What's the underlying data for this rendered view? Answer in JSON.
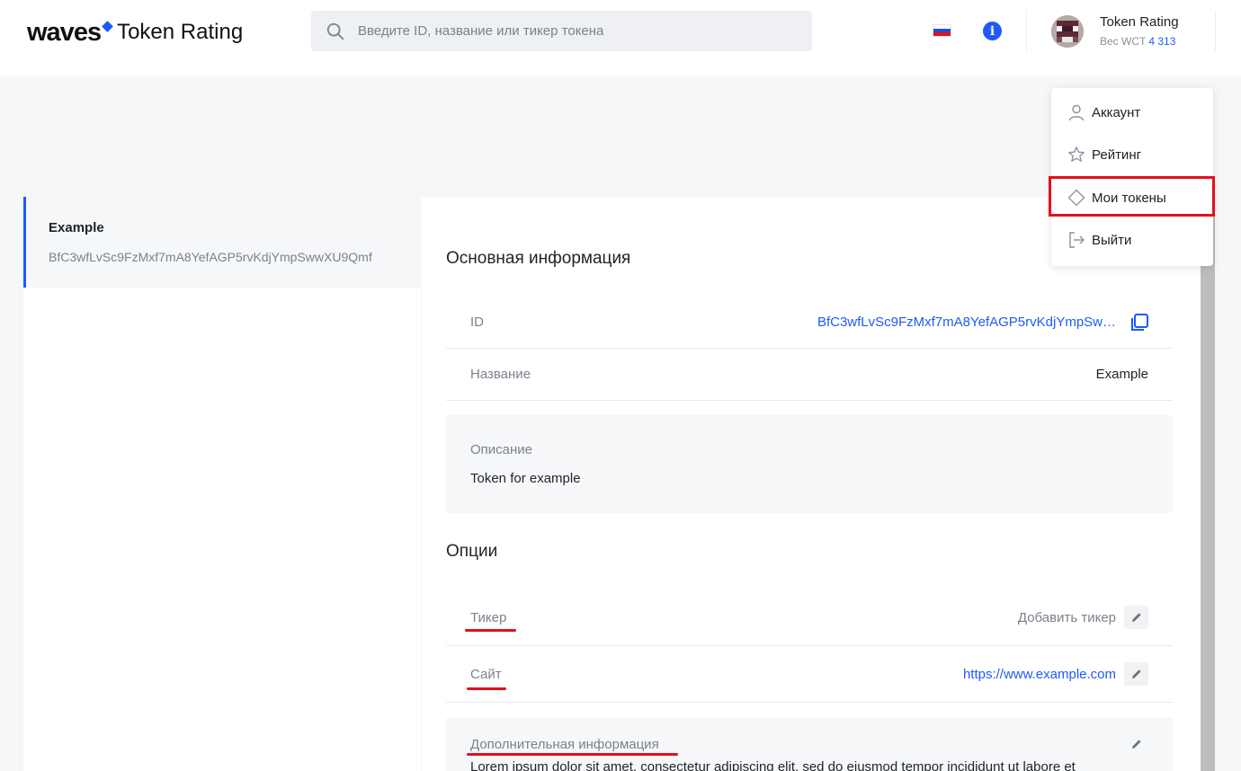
{
  "header": {
    "logo_main": "waves",
    "logo_sub": "Token Rating",
    "search_placeholder": "Введите ID, название или тикер токена",
    "user_name": "Token Rating",
    "user_weight_label": "Вес WCT",
    "user_weight_value": "4 313",
    "language": "ru",
    "icons": {
      "search": "search-icon",
      "flag": "russian-flag-icon",
      "info": "info-icon",
      "avatar": "avatar"
    }
  },
  "menu": {
    "items": [
      {
        "label": "Аккаунт",
        "icon": "user-icon"
      },
      {
        "label": "Рейтинг",
        "icon": "star-icon"
      },
      {
        "label": "Мои токены",
        "icon": "diamond-icon"
      },
      {
        "label": "Выйти",
        "icon": "logout-icon"
      }
    ],
    "highlighted_item": "Мои токены",
    "highlight_color": "#e3101b"
  },
  "sidebar": {
    "token_name": "Example",
    "token_id": "BfC3wfLvSc9FzMxf7mA8YefAGP5rvKdjYmpSwwXU9Qmf"
  },
  "main": {
    "basic_info_title": "Основная информация",
    "id_label": "ID",
    "id_value": "BfC3wfLvSc9FzMxf7mA8YefAGP5rvKdjYmpSw…",
    "name_label": "Название",
    "name_value": "Example",
    "description_label": "Описание",
    "description_value": "Token for example",
    "options_title": "Опции",
    "ticker_label": "Тикер",
    "ticker_value": "Добавить тикер",
    "site_label": "Сайт",
    "site_value": "https://www.example.com",
    "extra_label": "Дополнительная информация",
    "extra_value": "Lorem ipsum dolor sit amet, consectetur adipiscing elit, sed do eiusmod tempor incididunt ut labore et"
  },
  "colors": {
    "accent": "#1f5af6",
    "annotation": "#e3101b",
    "background": "#f6f7f9"
  }
}
